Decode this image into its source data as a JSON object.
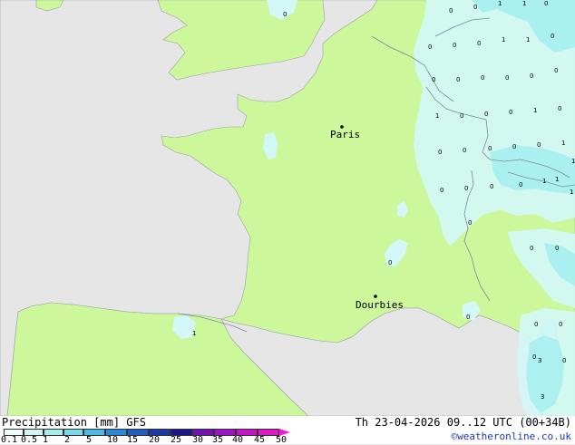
{
  "map": {
    "colors": {
      "sea": "#e6e6e6",
      "land": "#ccf79a",
      "precip_light": "#d4f7f7",
      "precip_medium": "#a6eef0",
      "border": "#9aa0ac"
    },
    "cities": [
      {
        "name": "Paris"
      },
      {
        "name": "Dourbies"
      }
    ],
    "values": [
      "0",
      "0",
      "0",
      "1",
      "1",
      "0",
      "0",
      "0",
      "0",
      "1",
      "1",
      "0",
      "0",
      "0",
      "0",
      "0",
      "0",
      "0",
      "1",
      "0",
      "0",
      "0",
      "1",
      "0",
      "0",
      "0",
      "0",
      "0",
      "0",
      "1",
      "1",
      "0",
      "1",
      "1",
      "1",
      "0",
      "0",
      "0",
      "0",
      "0",
      "0",
      "0",
      "1",
      "0",
      "0",
      "0",
      "0",
      "0",
      "3",
      "3"
    ]
  },
  "footer": {
    "title": "Precipitation [mm]  GFS",
    "valid_time": "Th 23-04-2026 09..12 UTC (00+34B)",
    "copyright": "©weatheronline.co.uk",
    "scale": {
      "colors": [
        "#f0fcfc",
        "#d2f5f5",
        "#a8ecee",
        "#7ad8ea",
        "#4cb8e6",
        "#2a88d8",
        "#1e5ec4",
        "#1a3aa8",
        "#18168a",
        "#7410b4",
        "#a010c8",
        "#c812c8",
        "#e016c8",
        "#f21ad8"
      ],
      "labels": [
        "0.1",
        "0.5",
        "1",
        "2",
        "5",
        "10",
        "15",
        "20",
        "25",
        "30",
        "35",
        "40",
        "45",
        "50"
      ]
    }
  }
}
